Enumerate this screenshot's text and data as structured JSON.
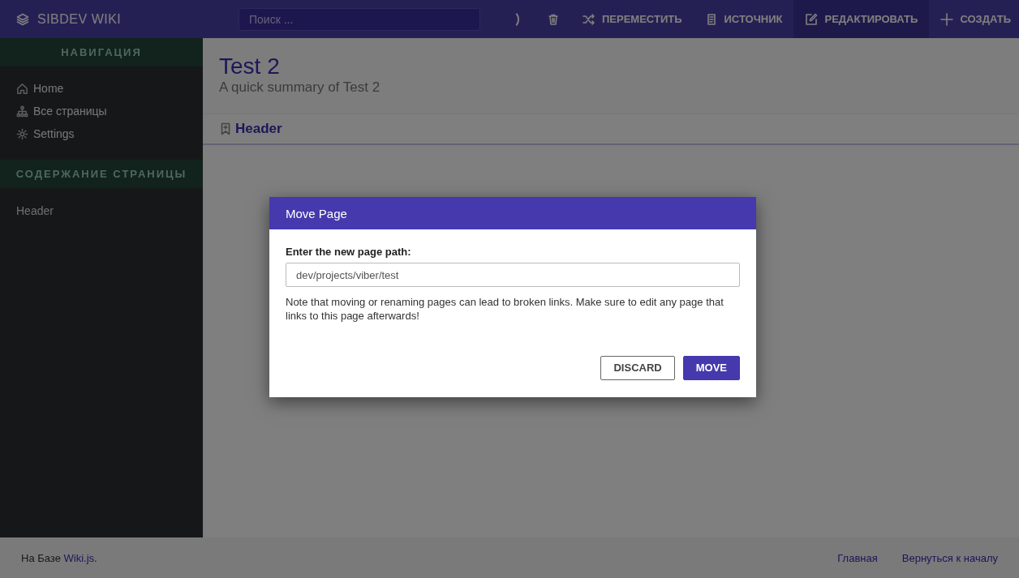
{
  "topbar": {
    "brand": "SIBDEV WIKI",
    "search": {
      "placeholder": "Поиск ..."
    },
    "actions": [
      {
        "kind": "trash"
      },
      {
        "kind": "move",
        "label": "ПЕРЕМЕСТИТЬ"
      },
      {
        "kind": "source",
        "label": "ИСТОЧНИК"
      },
      {
        "kind": "edit",
        "label": "РЕДАКТИРОВАТЬ"
      },
      {
        "kind": "create",
        "label": "СОЗДАТЬ"
      }
    ]
  },
  "sidebar": {
    "nav_title": "НАВИГАЦИЯ",
    "items": [
      {
        "kind": "home",
        "label": "Home"
      },
      {
        "kind": "pages",
        "label": "Все страницы"
      },
      {
        "kind": "settings",
        "label": "Settings"
      }
    ],
    "toc_title": "СОДЕРЖАНИЕ СТРАНИЦЫ",
    "toc": [
      "Header"
    ]
  },
  "page": {
    "title": "Test 2",
    "summary": "A quick summary of Test 2",
    "heading": "Header"
  },
  "footer": {
    "credit_prefix": "На Базе",
    "credit_link": "Wiki.js",
    "credit_suffix": ".",
    "links": [
      "Главная",
      "Вернуться к началу"
    ]
  },
  "dialog": {
    "title": "Move Page",
    "field_label": "Enter the new page path:",
    "value": "dev/projects/viber/test",
    "note": "Note that moving or renaming pages can lead to broken links. Make sure to edit any page that links to this page afterwards!",
    "buttons": [
      {
        "kind": "secondary",
        "label": "DISCARD"
      },
      {
        "kind": "primary",
        "label": "MOVE"
      }
    ]
  }
}
